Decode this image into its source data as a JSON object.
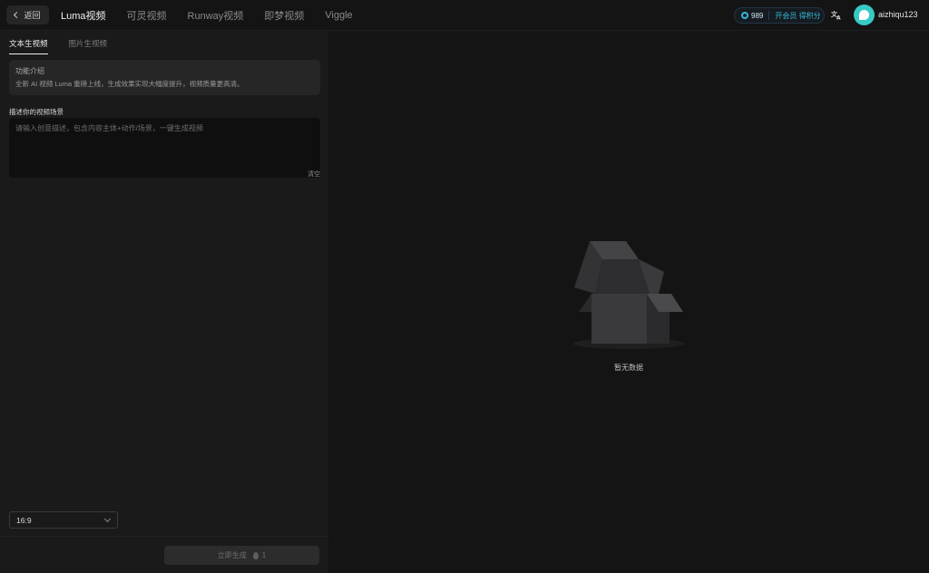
{
  "topbar": {
    "back_label": "返回",
    "nav": [
      {
        "label": "Luma视频",
        "active": true
      },
      {
        "label": "可灵视频",
        "active": false
      },
      {
        "label": "Runway视频",
        "active": false
      },
      {
        "label": "即梦视频",
        "active": false
      },
      {
        "label": "Viggle",
        "active": false
      }
    ],
    "points_value": "989",
    "vip_label": "开会员 得积分",
    "translate_icon": "translate-icon",
    "username": "aizhiqu123",
    "accent_color": "#35b8d8"
  },
  "left_panel": {
    "tabs": [
      {
        "label": "文本生视频",
        "active": true
      },
      {
        "label": "图片生视频",
        "active": false
      }
    ],
    "intro": {
      "title": "功能介绍",
      "description": "全新 AI 视频 Luma 重磅上线，生成效果实现大幅度提升，视频质量更高清。"
    },
    "prompt": {
      "label": "描述你的视频场景",
      "placeholder": "请输入创意描述，包含内容主体+动作/场景，一键生成视频",
      "value": "",
      "clear_label": "清空"
    },
    "ratio": {
      "selected": "16:9"
    },
    "generate": {
      "label": "立即生成",
      "cost": "1"
    }
  },
  "right_area": {
    "empty_text": "暂无数据"
  }
}
